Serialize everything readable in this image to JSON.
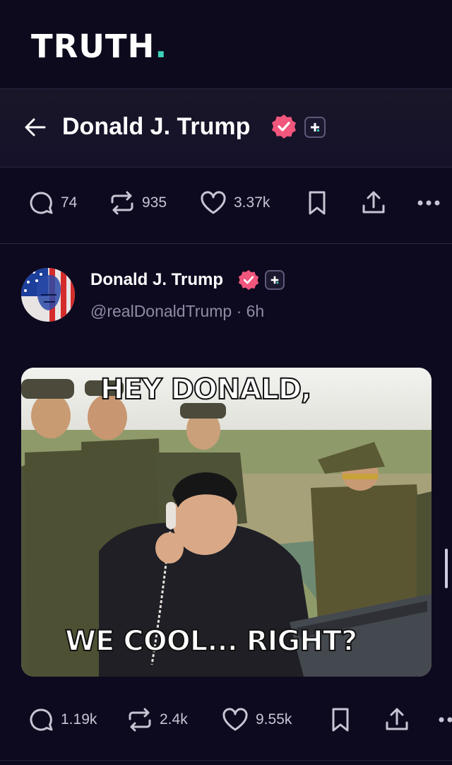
{
  "app": {
    "logo": "TRUTH",
    "logo_dot": "."
  },
  "title_bar": {
    "title": "Donald J. Trump"
  },
  "top_actions": {
    "replies": "74",
    "retruths": "935",
    "likes": "3.37k"
  },
  "post": {
    "author_name": "Donald J. Trump",
    "handle_time": "@realDonaldTrump · 6h",
    "image": {
      "caption_top": "HEY DONALD,",
      "caption_bottom": "WE COOL... RIGHT?"
    },
    "actions": {
      "replies": "1.19k",
      "retruths": "2.4k",
      "likes": "9.55k"
    }
  },
  "colors": {
    "background": "#0d0a1f",
    "brand_accent": "#3ed1b9",
    "verified": "#f1567d"
  }
}
